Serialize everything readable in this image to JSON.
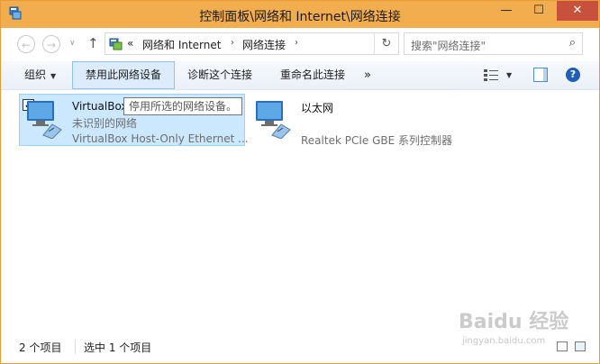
{
  "window": {
    "title": "控制面板\\网络和 Internet\\网络连接",
    "buttons": {
      "minimize": "—",
      "maximize": "☐",
      "close": "✕"
    }
  },
  "nav": {
    "back": "←",
    "forward": "→",
    "history": "∨",
    "up": "↑",
    "address": {
      "overflow": "«",
      "crumbs": [
        "网络和 Internet",
        "网络连接"
      ],
      "separator": "›",
      "refresh": "↻"
    },
    "search": {
      "placeholder": "搜索\"网络连接\"",
      "icon": "search-icon"
    }
  },
  "toolbar": {
    "organize": "组织",
    "disable": "禁用此网络设备",
    "diagnose": "诊断这个连接",
    "rename": "重命名此连接",
    "more": "»"
  },
  "items": [
    {
      "name": "VirtualBox",
      "status": "未识别的网络",
      "device": "VirtualBox Host-Only Ethernet ...",
      "selected": true,
      "checked": "✓"
    },
    {
      "name": "以太网",
      "status": "",
      "device": "Realtek PCIe GBE 系列控制器",
      "selected": false
    }
  ],
  "tooltip": "停用所选的网络设备。",
  "status": {
    "count": "2 个项目",
    "selected": "选中 1 个项目"
  },
  "watermark": {
    "brand": "Baidu 经验",
    "url": "jingyan.baidu.com"
  },
  "colors": {
    "titlebar": "#f1ad4e",
    "close": "#c7513d",
    "selection": "#cce8ff",
    "selection_border": "#99d1ff"
  }
}
